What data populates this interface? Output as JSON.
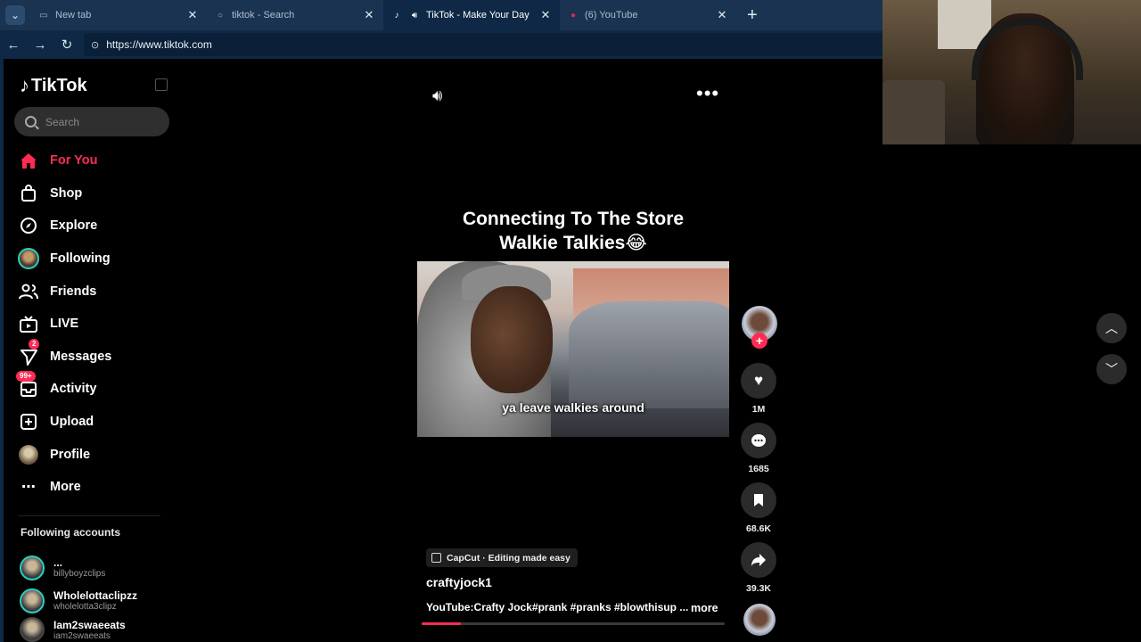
{
  "browser": {
    "tabs": [
      {
        "label": "New tab",
        "active": false
      },
      {
        "label": "tiktok - Search",
        "active": false
      },
      {
        "label": "TikTok - Make Your Day",
        "active": true
      },
      {
        "label": "(6) YouTube",
        "active": false
      }
    ],
    "url": "https://www.tiktok.com"
  },
  "sidebar": {
    "logo": "TikTok",
    "search_placeholder": "Search",
    "nav": [
      {
        "label": "For You",
        "icon": "home-icon",
        "active": true
      },
      {
        "label": "Shop",
        "icon": "shopping-bag-icon"
      },
      {
        "label": "Explore",
        "icon": "compass-icon"
      },
      {
        "label": "Following",
        "icon": "following-avatar-icon"
      },
      {
        "label": "Friends",
        "icon": "friends-icon"
      },
      {
        "label": "LIVE",
        "icon": "live-tv-icon"
      },
      {
        "label": "Messages",
        "icon": "paper-plane-icon",
        "badge": "2"
      },
      {
        "label": "Activity",
        "icon": "inbox-icon",
        "badge": "99+"
      },
      {
        "label": "Upload",
        "icon": "plus-square-icon"
      },
      {
        "label": "Profile",
        "icon": "profile-avatar-icon"
      },
      {
        "label": "More",
        "icon": "ellipsis-icon"
      }
    ],
    "following_title": "Following accounts",
    "accounts": [
      {
        "name": "...",
        "handle": "billyboyzclips"
      },
      {
        "name": "Wholelottaclipzz",
        "handle": "wholelotta3clipz"
      },
      {
        "name": "Iam2swaeeats",
        "handle": "iam2swaeeats"
      }
    ]
  },
  "video": {
    "caption_line1": "Connecting To The Store",
    "caption_line2": "Walkie Talkies😂",
    "subtitle": "ya leave walkies around",
    "capcut_label": "CapCut · Editing made easy",
    "author": "craftyjock1",
    "description": "YouTube:Crafty Jock#prank #pranks #blowthisup ...",
    "more_label": "more",
    "progress": 0.13
  },
  "actions": {
    "likes": "1M",
    "comments": "1685",
    "saves": "68.6K",
    "shares": "39.3K"
  },
  "colors": {
    "accent": "#fe2c55",
    "browser_bg": "#0e2846",
    "ring": "#2ad0c3"
  }
}
